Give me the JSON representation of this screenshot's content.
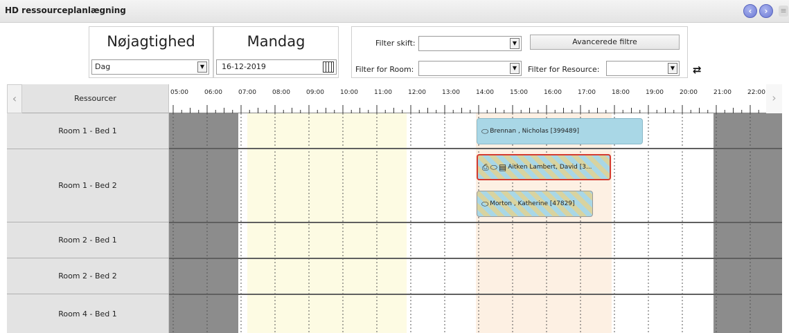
{
  "window": {
    "title": "HD ressourceplanlægning"
  },
  "nav": {
    "prev_icon": "chevron-left-icon",
    "next_icon": "chevron-right-icon",
    "menu_icon": "menu-icon",
    "prev_glyph": "‹",
    "next_glyph": "›",
    "menu_glyph": "≡"
  },
  "precision": {
    "heading": "Nøjagtighed",
    "value": "Dag"
  },
  "day": {
    "heading": "Mandag",
    "date": "16-12-2019"
  },
  "filters": {
    "shift_label": "Filter skift:",
    "shift_value": "",
    "room_label": "Filter for Room:",
    "room_value": "",
    "resource_label": "Filter for Resource:",
    "resource_value": "",
    "advanced_label": "Avancerede filtre"
  },
  "schedule": {
    "resources_header": "Ressourcer",
    "hours": [
      "05:00",
      "06:00",
      "07:00",
      "08:00",
      "09:00",
      "10:00",
      "11:00",
      "12:00",
      "13:00",
      "14:00",
      "15:00",
      "16:00",
      "17:00",
      "18:00",
      "19:00",
      "20:00",
      "21:00",
      "22:00"
    ],
    "rows": [
      {
        "label": "Room 1 - Bed 1"
      },
      {
        "label": "Room 1 - Bed 2"
      },
      {
        "label": "Room 2 - Bed 1"
      },
      {
        "label": "Room 2 - Bed 2"
      },
      {
        "label": "Room 4 - Bed 1"
      }
    ],
    "events": [
      {
        "text": "Brennan , Nicholas [399489]",
        "icons": [
          "pill-icon"
        ]
      },
      {
        "text": "Aitken Lambert, David [3...",
        "icons": [
          "printer-icon",
          "pill-icon",
          "document-icon"
        ]
      },
      {
        "text": "Morton , Katherine [47829]",
        "icons": [
          "pill-icon"
        ]
      }
    ]
  },
  "colors": {
    "accent": "#6c79d4",
    "closed_zone": "#8c8c8c",
    "morning_shift": "#fdfbe3",
    "afternoon_shift": "#fdf0e3",
    "event": "#a9d7e6",
    "event_alert": "#d43a30"
  }
}
